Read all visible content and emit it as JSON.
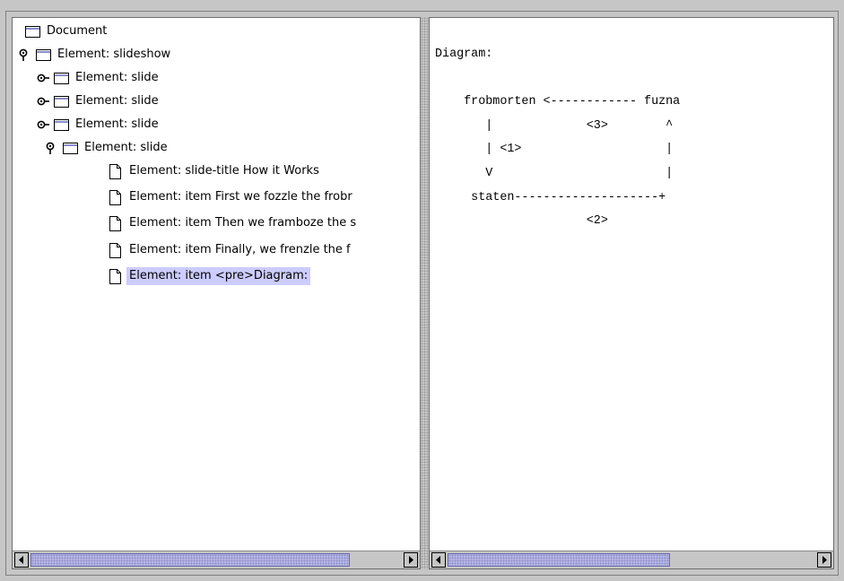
{
  "tree": {
    "nodes": [
      {
        "label": "Document",
        "icon": "folder-icon",
        "handle": "none"
      },
      {
        "label": "Element: slideshow",
        "icon": "folder-icon",
        "handle": "expanded"
      },
      {
        "label": "Element: slide",
        "icon": "folder-icon",
        "handle": "collapsed"
      },
      {
        "label": "Element: slide",
        "icon": "folder-icon",
        "handle": "collapsed"
      },
      {
        "label": "Element: slide",
        "icon": "folder-icon",
        "handle": "collapsed"
      },
      {
        "label": "Element: slide",
        "icon": "folder-icon",
        "handle": "expanded"
      },
      {
        "label": "Element: slide-title How it Works",
        "icon": "document-icon",
        "handle": "none"
      },
      {
        "label": "Element: item First we fozzle the frobr",
        "icon": "document-icon",
        "handle": "none"
      },
      {
        "label": "Element: item Then we framboze the s",
        "icon": "document-icon",
        "handle": "none"
      },
      {
        "label": "Element: item Finally, we frenzle the f",
        "icon": "document-icon",
        "handle": "none"
      },
      {
        "label": "Element: item <pre>Diagram:",
        "icon": "document-icon",
        "handle": "none",
        "selected": true
      }
    ]
  },
  "content": {
    "lines": [
      "Diagram:",
      "",
      "    frobmorten <------------ fuzna",
      "       |             <3>        ^",
      "       | <1>                    |",
      "       V                        |",
      "     staten--------------------+",
      "                     <2>"
    ]
  },
  "colors": {
    "selection": "#ccccff",
    "scroll_thumb": "#b5b5e6",
    "panel_bg": "#c6c6c6"
  }
}
